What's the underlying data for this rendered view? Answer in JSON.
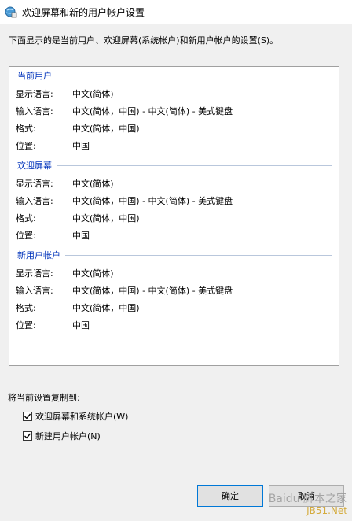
{
  "window": {
    "title": "欢迎屏幕和新的用户帐户设置"
  },
  "intro_text": "下面显示的是当前用户、欢迎屏幕(系统帐户)和新用户帐户的设置(S)。",
  "sections": [
    {
      "heading": "当前用户",
      "rows": [
        {
          "label": "显示语言:",
          "value": "中文(简体)"
        },
        {
          "label": "输入语言:",
          "value": "中文(简体，中国) - 中文(简体) - 美式键盘"
        },
        {
          "label": "格式:",
          "value": "中文(简体，中国)"
        },
        {
          "label": "位置:",
          "value": "中国"
        }
      ]
    },
    {
      "heading": "欢迎屏幕",
      "rows": [
        {
          "label": "显示语言:",
          "value": "中文(简体)"
        },
        {
          "label": "输入语言:",
          "value": "中文(简体，中国) - 中文(简体) - 美式键盘"
        },
        {
          "label": "格式:",
          "value": "中文(简体，中国)"
        },
        {
          "label": "位置:",
          "value": "中国"
        }
      ]
    },
    {
      "heading": "新用户帐户",
      "rows": [
        {
          "label": "显示语言:",
          "value": "中文(简体)"
        },
        {
          "label": "输入语言:",
          "value": "中文(简体，中国) - 中文(简体) - 美式键盘"
        },
        {
          "label": "格式:",
          "value": "中文(简体，中国)"
        },
        {
          "label": "位置:",
          "value": "中国"
        }
      ]
    }
  ],
  "copy_settings": {
    "label": "将当前设置复制到:",
    "options": [
      {
        "label": "欢迎屏幕和系统帐户(W)",
        "checked": true
      },
      {
        "label": "新建用户帐户(N)",
        "checked": true
      }
    ]
  },
  "buttons": {
    "ok": "确定",
    "cancel": "取消"
  },
  "watermark": {
    "line1": "Baidu 脚本之家",
    "line2": "JB51.Net"
  },
  "colors": {
    "section_heading": "#0033bb",
    "ok_border": "#0078d7"
  }
}
